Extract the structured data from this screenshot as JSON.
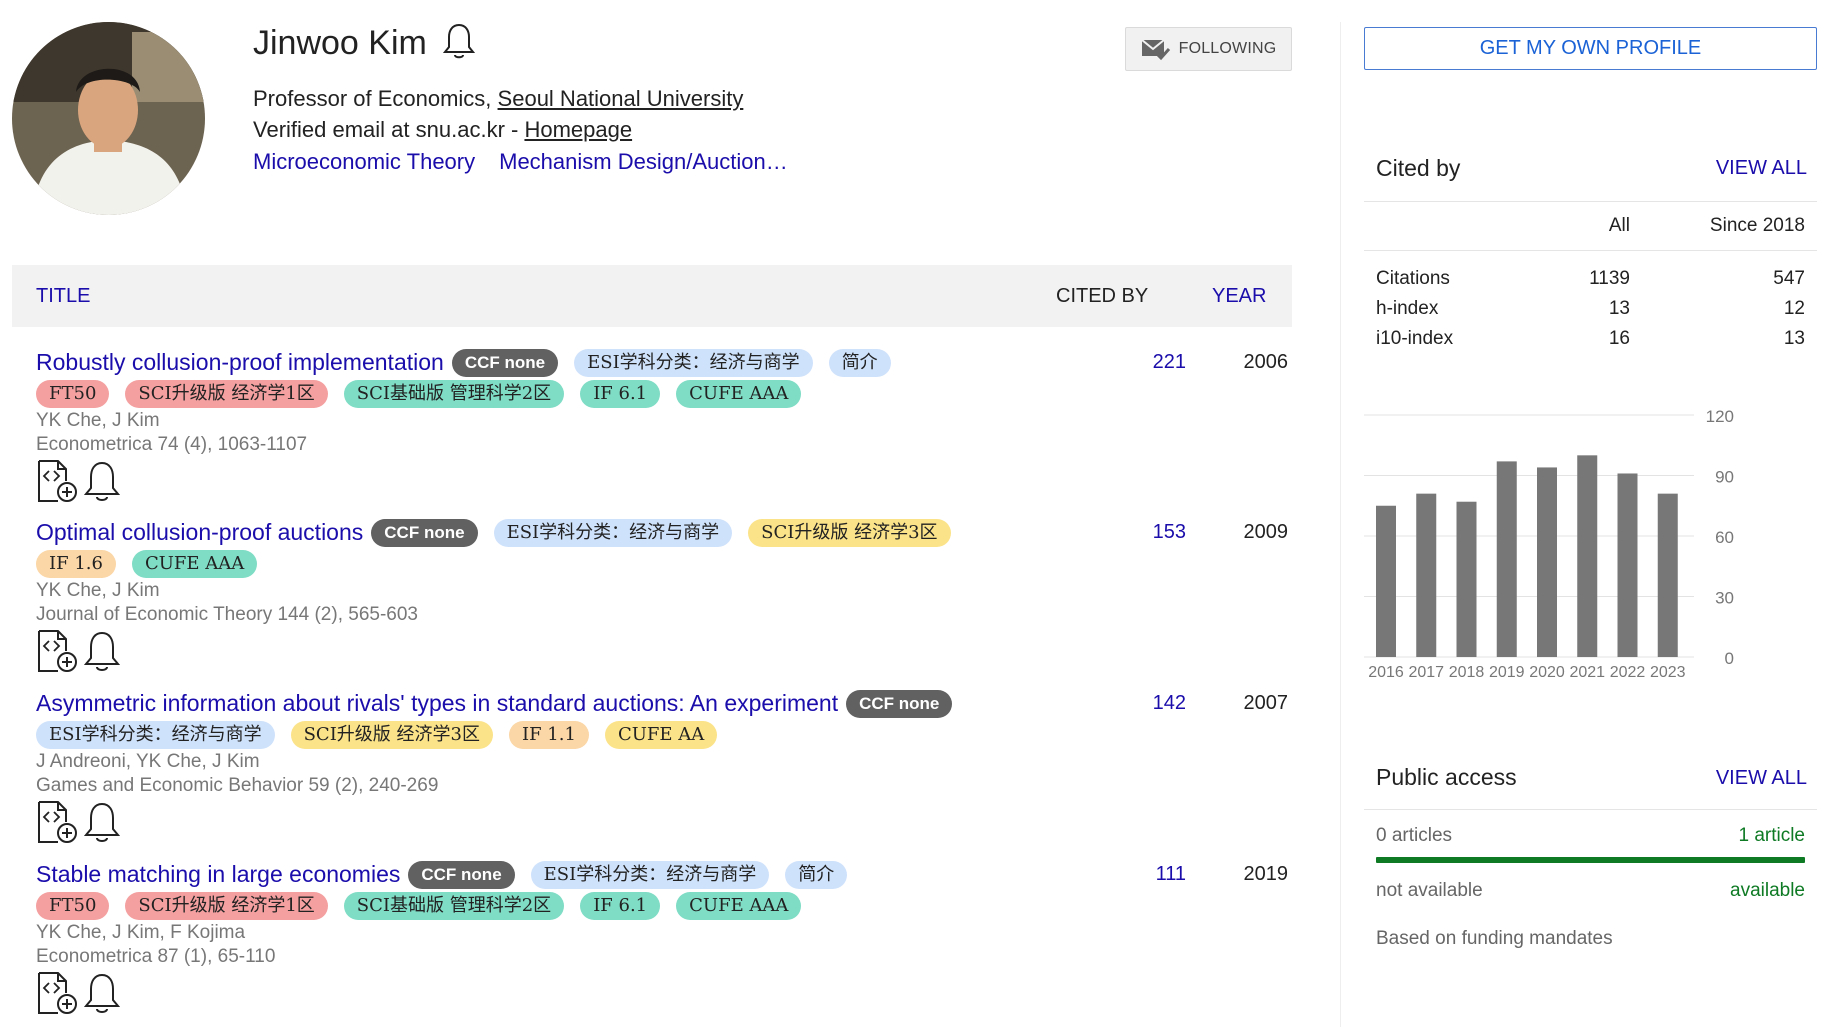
{
  "profile": {
    "name": "Jinwoo Kim",
    "affiliation_prefix": "Professor of Economics, ",
    "affiliation_link": "Seoul National University",
    "email_prefix": "Verified email at snu.ac.kr - ",
    "homepage_link": "Homepage",
    "interests": [
      "Microeconomic Theory",
      "Mechanism Design/Auction…"
    ],
    "following_label": "FOLLOWING"
  },
  "table": {
    "col_title": "TITLE",
    "col_cited": "CITED BY",
    "col_year": "YEAR"
  },
  "articles": [
    {
      "title": "Robustly collusion-proof implementation",
      "tags_line1": [
        "CCF none",
        "ESI学科分类：经济与商学",
        "简介"
      ],
      "tags_line2": [
        "FT50",
        "SCI升级版 经济学1区",
        "SCI基础版 管理科学2区",
        "IF 6.1",
        "CUFE AAA"
      ],
      "authors": "YK Che, J Kim",
      "venue": "Econometrica 74 (4), 1063-1107",
      "cited": "221",
      "year": "2006"
    },
    {
      "title": "Optimal collusion-proof auctions",
      "tags_line1": [
        "CCF none",
        "ESI学科分类：经济与商学",
        "SCI升级版 经济学3区"
      ],
      "tags_line2": [
        "IF 1.6",
        "CUFE AAA"
      ],
      "authors": "YK Che, J Kim",
      "venue": "Journal of Economic Theory 144 (2), 565-603",
      "cited": "153",
      "year": "2009"
    },
    {
      "title": "Asymmetric information about rivals' types in standard auctions: An experiment",
      "tags_line1": [
        "CCF none"
      ],
      "tags_line2": [
        "ESI学科分类：经济与商学",
        "SCI升级版 经济学3区",
        "IF 1.1",
        "CUFE AA"
      ],
      "authors": "J Andreoni, YK Che, J Kim",
      "venue": "Games and Economic Behavior 59 (2), 240-269",
      "cited": "142",
      "year": "2007"
    },
    {
      "title": "Stable matching in large economies",
      "tags_line1": [
        "CCF none",
        "ESI学科分类：经济与商学",
        "简介"
      ],
      "tags_line2": [
        "FT50",
        "SCI升级版 经济学1区",
        "SCI基础版 管理科学2区",
        "IF 6.1",
        "CUFE AAA"
      ],
      "authors": "YK Che, J Kim, F Kojima",
      "venue": "Econometrica 87 (1), 65-110",
      "cited": "111",
      "year": "2019"
    }
  ],
  "sidebar": {
    "own_profile_label": "GET MY OWN PROFILE",
    "cited_by_title": "Cited by",
    "view_all": "VIEW ALL",
    "col_all": "All",
    "col_since": "Since 2018",
    "stats": [
      {
        "label": "Citations",
        "all": "1139",
        "since": "547"
      },
      {
        "label": "h-index",
        "all": "13",
        "since": "12"
      },
      {
        "label": "i10-index",
        "all": "16",
        "since": "13"
      }
    ],
    "public_access_title": "Public access",
    "not_available_count": "0 articles",
    "available_count": "1 article",
    "not_available_label": "not available",
    "available_label": "available",
    "mandates_note": "Based on funding mandates"
  },
  "colors": {
    "link": "#1a0dab",
    "ccf_tag": "#616161",
    "blue_tag": "#cfe2fb",
    "red_tag": "#f4a0a0",
    "teal_tag": "#7fdcc5",
    "yellow_tag": "#fbe38a",
    "orange_tag": "#fbd6a6",
    "bar": "#777777",
    "access_green": "#0e7a24"
  },
  "chart_data": {
    "type": "bar",
    "categories": [
      "2016",
      "2017",
      "2018",
      "2019",
      "2020",
      "2021",
      "2022",
      "2023"
    ],
    "values": [
      75,
      81,
      77,
      97,
      94,
      100,
      91,
      81
    ],
    "ylim": [
      0,
      120
    ],
    "yticks": [
      "0",
      "30",
      "60",
      "90",
      "120"
    ],
    "title": "",
    "xlabel": "",
    "ylabel": "",
    "grid": true
  }
}
